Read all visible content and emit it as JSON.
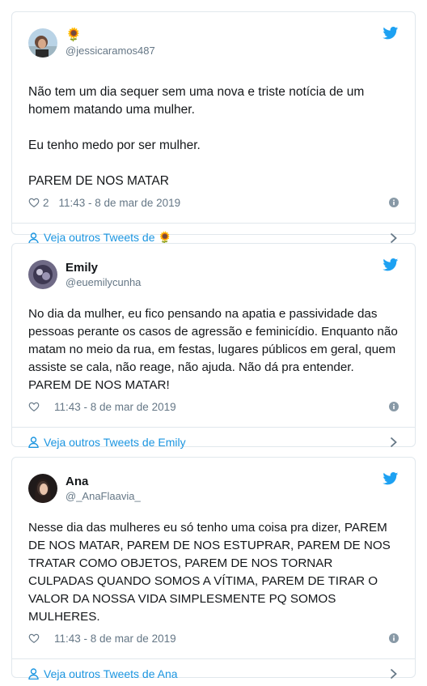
{
  "tweets": [
    {
      "name": "🌻",
      "handle": "@jessicaramos487",
      "text": "Não tem um dia sequer sem uma nova e triste notícia de um homem matando uma mulher.\n\nEu tenho medo por ser mulher.\n\nPAREM DE NOS MATAR",
      "likes": "2",
      "timestamp": "11:43 - 8 de mar de 2019",
      "footer": "Veja outros Tweets de 🌻"
    },
    {
      "name": "Emily",
      "handle": "@euemilycunha",
      "text": "No dia da mulher, eu fico pensando na apatia e passividade das pessoas perante os casos de agressão e feminicídio. Enquanto não matam no meio da rua, em festas, lugares públicos em geral, quem assiste se cala, não reage, não ajuda. Não dá pra entender. PAREM DE NOS MATAR!",
      "likes": "",
      "timestamp": "11:43 - 8 de mar de 2019",
      "footer": "Veja outros Tweets de Emily"
    },
    {
      "name": "Ana",
      "handle": "@_AnaFlaavia_",
      "text": "Nesse dia das mulheres eu só tenho uma coisa pra dizer, PAREM DE NOS MATAR, PAREM DE NOS ESTUPRAR, PAREM DE NOS TRATAR COMO OBJETOS, PAREM DE NOS TORNAR CULPADAS QUANDO SOMOS A VÍTIMA, PAREM DE TIRAR O VALOR DA NOSSA VIDA SIMPLESMENTE PQ SOMOS MULHERES.",
      "likes": "",
      "timestamp": "11:43 - 8 de mar de 2019",
      "footer": "Veja outros Tweets de Ana"
    }
  ],
  "colors": {
    "accent": "#1da1f2",
    "link": "#1b95e0",
    "muted": "#657786",
    "border": "#e1e8ed"
  }
}
